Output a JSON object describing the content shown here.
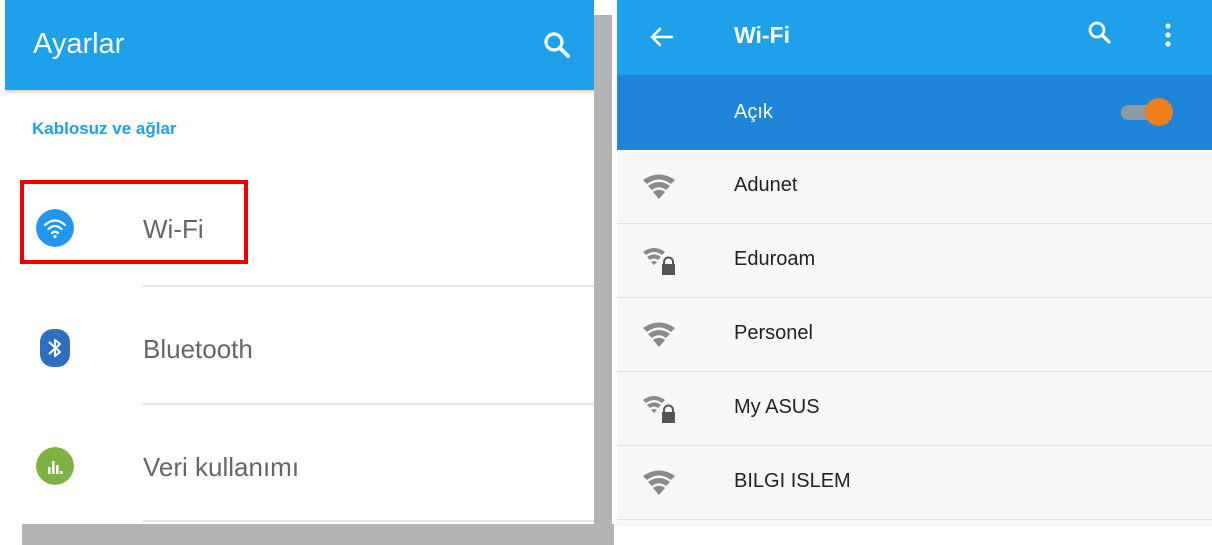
{
  "left": {
    "title": "Ayarlar",
    "section": "Kablosuz ve ağlar",
    "items": [
      {
        "label": "Wi-Fi",
        "icon": "wifi-icon",
        "color": "#2196f3"
      },
      {
        "label": "Bluetooth",
        "icon": "bluetooth-icon",
        "color": "#2f6fc0"
      },
      {
        "label": "Veri kullanımı",
        "icon": "data-usage-icon",
        "color": "#7cb342"
      }
    ]
  },
  "right": {
    "title": "Wi-Fi",
    "switch_label": "Açık",
    "switch_on": true,
    "networks": [
      {
        "name": "Adunet",
        "secured": false
      },
      {
        "name": "Eduroam",
        "secured": true
      },
      {
        "name": "Personel",
        "secured": false
      },
      {
        "name": "My ASUS",
        "secured": true
      },
      {
        "name": "BILGI ISLEM",
        "secured": false
      }
    ]
  },
  "colors": {
    "appbar": "#1ea0ea",
    "switchbar": "#1d86d9",
    "toggle": "#f07f1a",
    "highlight": "#ef0000"
  }
}
